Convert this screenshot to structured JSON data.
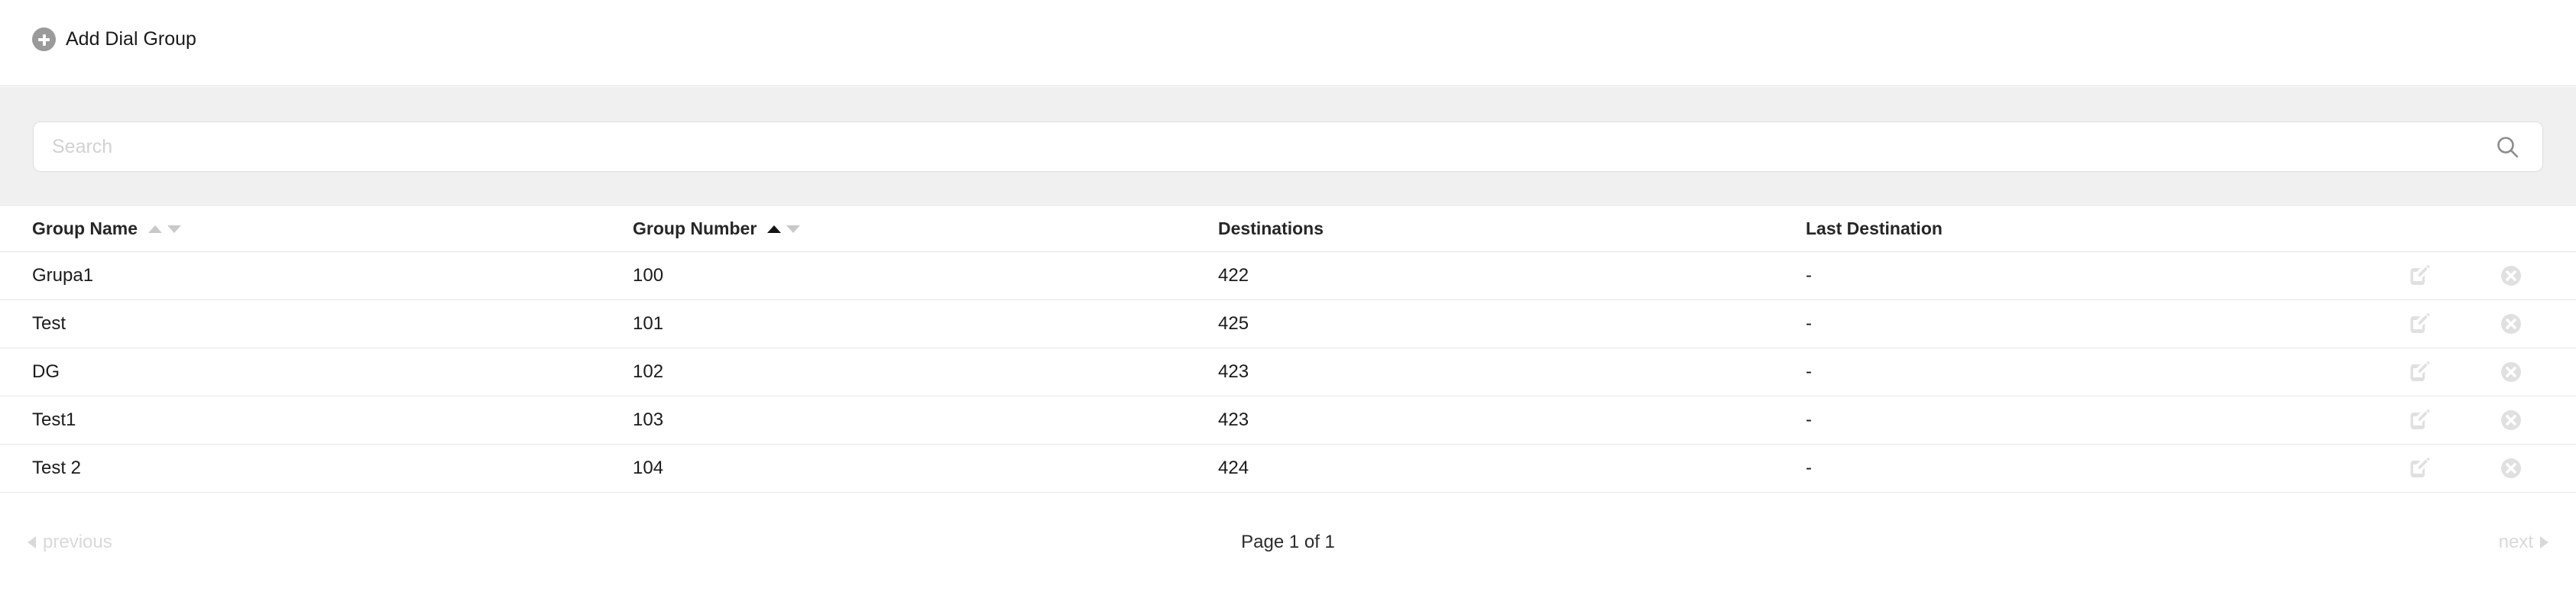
{
  "toolbar": {
    "add_label": "Add Dial Group",
    "add_icon": "plus-circle-icon"
  },
  "search": {
    "placeholder": "Search",
    "value": "",
    "icon": "search-icon"
  },
  "table": {
    "columns": [
      {
        "key": "group_name",
        "label": "Group Name",
        "sortable": true,
        "sort_state": "none"
      },
      {
        "key": "group_number",
        "label": "Group Number",
        "sortable": true,
        "sort_state": "asc"
      },
      {
        "key": "destinations",
        "label": "Destinations",
        "sortable": false,
        "sort_state": "none"
      },
      {
        "key": "last_destination",
        "label": "Last Destination",
        "sortable": false,
        "sort_state": "none"
      }
    ],
    "rows": [
      {
        "group_name": "Grupa1",
        "group_number": "100",
        "destinations": "422",
        "last_destination": "-"
      },
      {
        "group_name": "Test",
        "group_number": "101",
        "destinations": "425",
        "last_destination": "-"
      },
      {
        "group_name": "DG",
        "group_number": "102",
        "destinations": "423",
        "last_destination": "-"
      },
      {
        "group_name": "Test1",
        "group_number": "103",
        "destinations": "423",
        "last_destination": "-"
      },
      {
        "group_name": "Test 2",
        "group_number": "104",
        "destinations": "424",
        "last_destination": "-"
      }
    ],
    "row_actions": {
      "edit_icon": "edit-pencil-icon",
      "delete_icon": "delete-circle-x-icon"
    }
  },
  "pagination": {
    "previous_label": "previous",
    "next_label": "next",
    "page_info": "Page 1 of 1",
    "previous_enabled": false,
    "next_enabled": false
  },
  "colors": {
    "panel_background": "#f0f0f0",
    "text_primary": "#1b1b1b",
    "text_muted": "#d9d9d9",
    "icon_gray": "#9a9a9a",
    "row_border": "#e8e8e8"
  }
}
